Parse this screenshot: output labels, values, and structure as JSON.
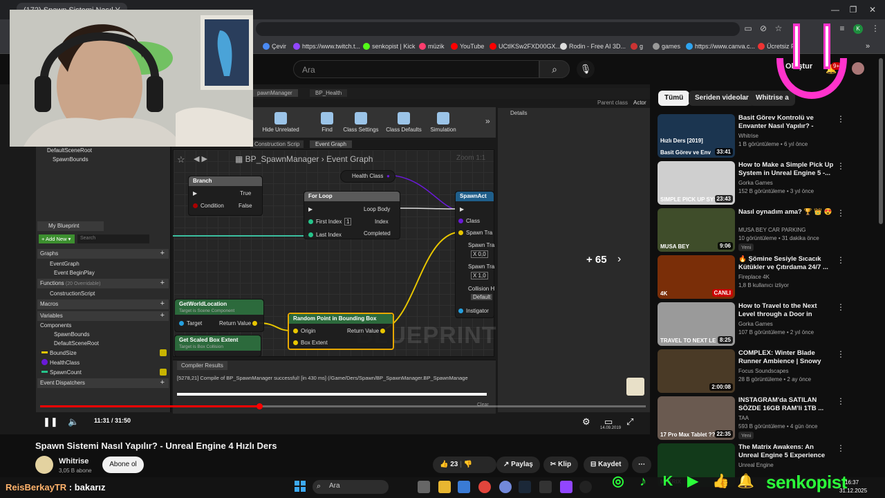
{
  "browser": {
    "tab_title": "(172) Spawn Sistemi Nasıl Y...",
    "bookmarks": [
      "Çevir",
      "https://www.twitch.t...",
      "senkopist | Kick",
      "müzik",
      "YouTube",
      "UCtIKSw2FXD00GX...",
      "Rodin - Free AI 3D...",
      "g",
      "games",
      "https://www.canva.c...",
      "Ücretsiz PN"
    ],
    "profile_initial": "K"
  },
  "youtube": {
    "search_placeholder": "Ara",
    "create_label": "Oluştur",
    "bell_badge": "9+"
  },
  "video": {
    "ue": {
      "tabs": [
        "pawnManager",
        "BP_Health"
      ],
      "parent_class_label": "Parent class",
      "parent_class_value": "Actor",
      "toolbar": [
        "Hide Unrelated",
        "Find",
        "Class Settings",
        "Class Defaults",
        "Simulation"
      ],
      "subtabs": [
        "Construction Scrip",
        "Event Graph"
      ],
      "details_label": "Details",
      "components_top": [
        "DefaultSceneRoot",
        "SpawnBounds"
      ],
      "my_blueprint": "My Blueprint",
      "add_new": "+ Add New ▾",
      "bp_search": "Search",
      "sections": {
        "graphs": "Graphs",
        "event_graph": "EventGraph",
        "event_begin_play": "Event BeginPlay",
        "functions": "Functions",
        "functions_count": "(20 Overridable)",
        "construction_script": "ConstructionScript",
        "macros": "Macros",
        "variables": "Variables",
        "components": "Components",
        "comp_items": [
          "SpawnBounds",
          "DefaultSceneRoot"
        ],
        "vars": [
          "BoundSize",
          "HealthClass",
          "SpawnCount"
        ],
        "event_dispatchers": "Event Dispatchers"
      },
      "graph_breadcrumb": "BP_SpawnManager",
      "graph_name": "Event Graph",
      "zoom": "Zoom 1:1",
      "watermark": "BLUEPRINT",
      "nodes": {
        "health_class": "Health Class",
        "branch": "Branch",
        "branch_true": "True",
        "branch_condition": "Condition",
        "branch_false": "False",
        "for_loop": "For Loop",
        "loop_body": "Loop Body",
        "first_index": "First Index",
        "index": "Index",
        "last_index": "Last Index",
        "completed": "Completed",
        "first_index_default": "1",
        "spawn_actor": "SpawnAct",
        "class_pin": "Class",
        "spawn_tra1": "Spawn Tra",
        "spawn_tra2": "Spawn Tra",
        "spawn_tra3": "Spawn Tra",
        "x_val1": "X 0,0",
        "x_val2": "X 1,0",
        "collision": "Collision H",
        "default": "Default",
        "instigator": "Instigator",
        "get_world_location": "GetWorldLocation",
        "gwl_sub": "Target is Scene Component",
        "target": "Target",
        "return_value": "Return Value",
        "get_scaled_box": "Get Scaled Box Extent",
        "gsb_sub": "Target is Box Collision",
        "random_point": "Random Point in Bounding Box",
        "origin": "Origin",
        "rp_return": "Return Value",
        "box_extent": "Box Extent"
      },
      "compiler_title": "Compiler Results",
      "compiler_line": "[5278,21] Compile of BP_SpawnManager successful! [in 430 ms] (/Game/Ders/Spawn/BP_SpawnManager.BP_SpawnManage",
      "clear": "Clear",
      "taskbar_date": "14.09.2019"
    },
    "more_count": "+ 65",
    "time": "11:31 / 31:50",
    "progress": 0.362
  },
  "watch": {
    "title": "Spawn Sistemi Nasıl Yapılır? - Unreal Engine 4 Hızlı Ders",
    "channel": "Whitrise",
    "subs": "3,05 B abone",
    "subscribe": "Abone ol",
    "likes": "23",
    "share": "Paylaş",
    "clip": "Klip",
    "save": "Kaydet"
  },
  "sidebar": {
    "chips": [
      "Tümü",
      "Seriden videolar",
      "Whitrise a"
    ],
    "recs": [
      {
        "title": "Basit Görev Kontrolü ve Envanter Nasıl Yapılır? - Unrea...",
        "channel": "Whitrise",
        "meta": "1 B görüntüleme • 6 yıl önce",
        "duration": "33:41",
        "thumb_text": "Basit Görev ve Env",
        "thumb_top": "Hızlı Ders [2019]",
        "color": "#1b3550"
      },
      {
        "title": "How to Make a Simple Pick Up System in Unreal Engine 5 -...",
        "channel": "Gorka Games",
        "meta": "152 B görüntüleme • 3 yıl önce",
        "duration": "23:43",
        "thumb_text": "SIMPLE PICK UP SYSTEM",
        "color": "#cfcfcf"
      },
      {
        "title": "Nasıl oynadım ama? 🏆 👑 😍",
        "channel": "MUSA BEY CAR PARKING",
        "meta": "10 görüntüleme • 31 dakika önce",
        "duration": "9:06",
        "new": "Yeni",
        "thumb_text": "MUSA BEY",
        "color": "#3f4d2a"
      },
      {
        "title": "🔥 Şömine Sesiyle Sıcacık Kütükler ve Çıtırdama 24/7 ...",
        "channel": "Fireplace 4K",
        "meta": "1,8 B kullanıcı izliyor",
        "duration": "CANLI",
        "live": true,
        "thumb_text": "4K",
        "color": "#7a2e08"
      },
      {
        "title": "How to Travel to the Next Level through a Door in Unreal Engin...",
        "channel": "Gorka Games",
        "meta": "107 B görüntüleme • 2 yıl önce",
        "duration": "8:25",
        "thumb_text": "TRAVEL TO NEXT LE",
        "color": "#9a9a9a"
      },
      {
        "title": "COMPLEX: Winter Blade Runner Ambience | Snowy Cyberpunk ...",
        "channel": "Focus Soundscapes",
        "meta": "28 B görüntüleme • 2 ay önce",
        "duration": "2:00:08",
        "thumb_text": "",
        "color": "#4a3a26"
      },
      {
        "title": "INSTAGRAM'da SATILAN SÖZDE 16GB RAM'li 1TB ...",
        "channel": "TAA",
        "meta": "593 B görüntüleme • 4 gün önce",
        "duration": "22:35",
        "new": "Yeni",
        "thumb_text": "17 Pro Max Tablet ??",
        "color": "#6a5a50"
      },
      {
        "title": "The Matrix Awakens: An Unreal Engine 5 Experience",
        "channel": "Unreal Engine",
        "meta": "",
        "duration": "",
        "thumb_text": "MATRIX",
        "color": "#123a1a"
      }
    ]
  },
  "overlay": {
    "chat_user": "ReisBerkayTR",
    "chat_sep": " : ",
    "chat_msg": "bakarız",
    "streamer": "senkopist"
  },
  "taskbar": {
    "search": "Ara",
    "time": "16:37",
    "date": "31.12.2025"
  }
}
